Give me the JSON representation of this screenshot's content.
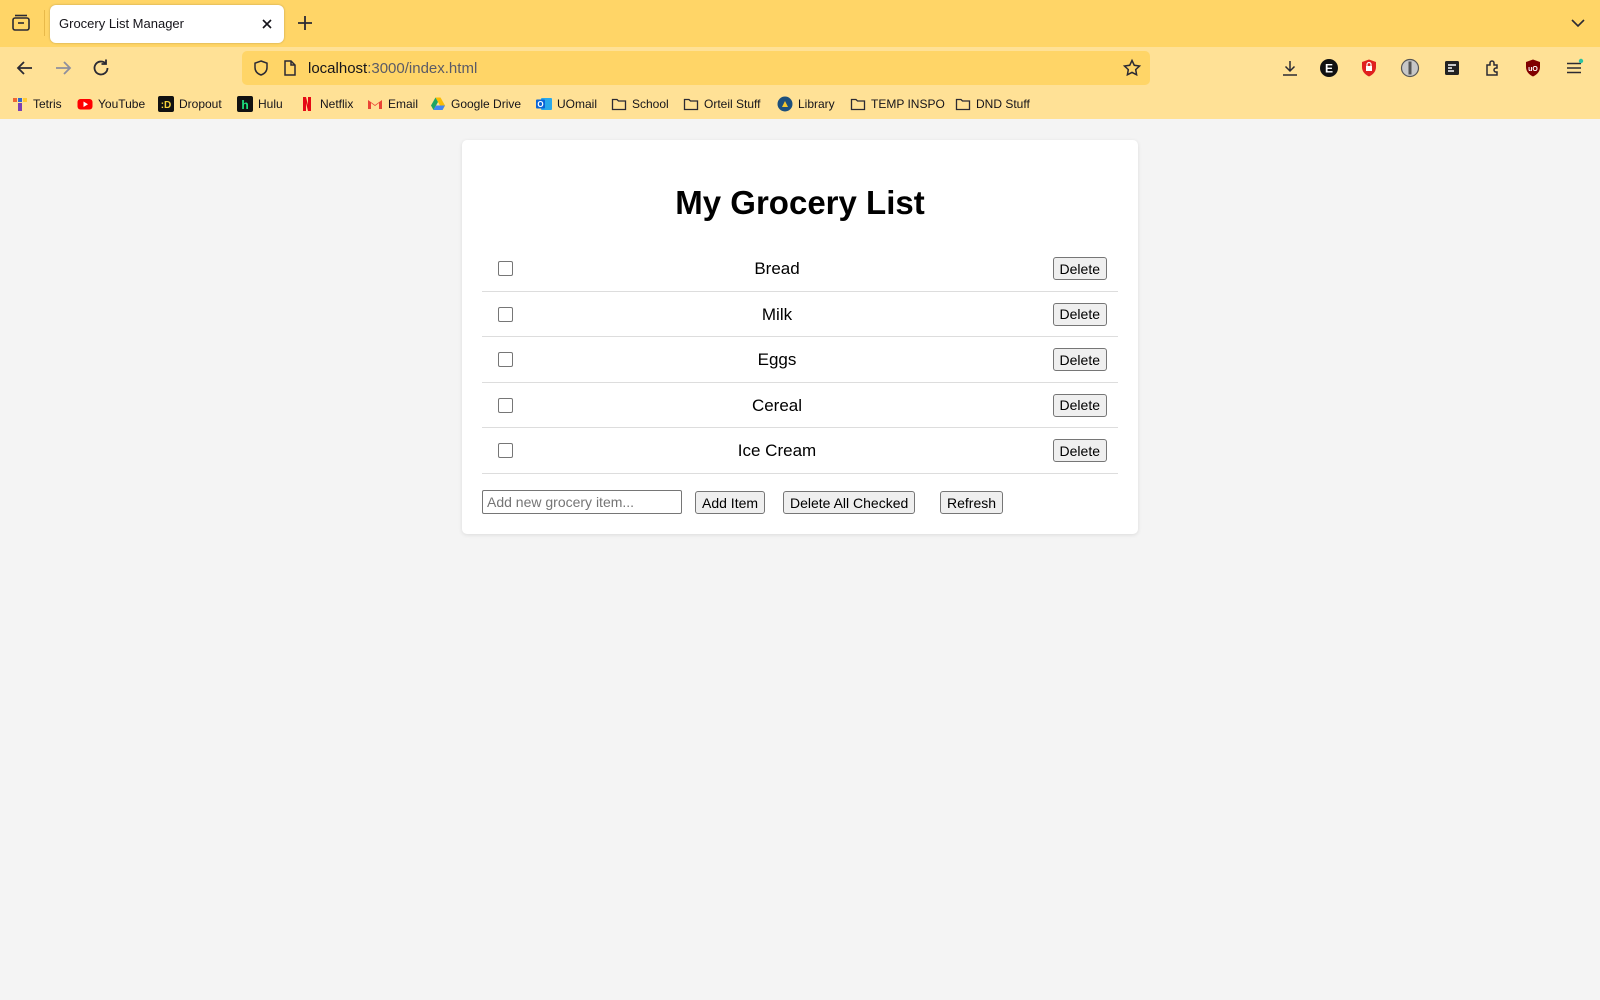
{
  "browser": {
    "tab": {
      "title": "Grocery List Manager"
    },
    "url": {
      "host": "localhost",
      "rest": ":3000/index.html"
    },
    "toolbar_icons": [
      "downloads-icon",
      "extension-e-icon",
      "bitwarden-icon",
      "privacy-badger-icon",
      "reader-icon",
      "extensions-icon",
      "ublock-origin-icon",
      "menu-icon"
    ],
    "bookmarks": [
      {
        "label": "Tetris",
        "icon": "tetris-icon",
        "color": "#7b3fb3"
      },
      {
        "label": "YouTube",
        "icon": "youtube-icon",
        "color": "#ff0000"
      },
      {
        "label": "Dropout",
        "icon": "dropout-icon",
        "color": "#111111"
      },
      {
        "label": "Hulu",
        "icon": "hulu-icon",
        "color": "#111111"
      },
      {
        "label": "Netflix",
        "icon": "netflix-icon",
        "color": "#e50914"
      },
      {
        "label": "Email",
        "icon": "gmail-icon",
        "color": "#ea4335"
      },
      {
        "label": "Google Drive",
        "icon": "google-drive-icon",
        "color": "#1fa463"
      },
      {
        "label": "UOmail",
        "icon": "outlook-icon",
        "color": "#0a64d6"
      },
      {
        "label": "School",
        "icon": "folder-icon",
        "color": "#2b2a33"
      },
      {
        "label": "Orteil Stuff",
        "icon": "folder-icon",
        "color": "#2b2a33"
      },
      {
        "label": "Library",
        "icon": "library-icon",
        "color": "#1c4f7c"
      },
      {
        "label": "TEMP INSPO",
        "icon": "folder-icon",
        "color": "#2b2a33"
      },
      {
        "label": "DND Stuff",
        "icon": "folder-icon",
        "color": "#2b2a33"
      }
    ]
  },
  "app": {
    "title": "My Grocery List",
    "items": [
      {
        "name": "Bread",
        "checked": false,
        "delete_label": "Delete"
      },
      {
        "name": "Milk",
        "checked": false,
        "delete_label": "Delete"
      },
      {
        "name": "Eggs",
        "checked": false,
        "delete_label": "Delete"
      },
      {
        "name": "Cereal",
        "checked": false,
        "delete_label": "Delete"
      },
      {
        "name": "Ice Cream",
        "checked": false,
        "delete_label": "Delete"
      }
    ],
    "new_item": {
      "value": "",
      "placeholder": "Add new grocery item..."
    },
    "buttons": {
      "add": "Add Item",
      "delete_checked": "Delete All Checked",
      "refresh": "Refresh"
    }
  }
}
